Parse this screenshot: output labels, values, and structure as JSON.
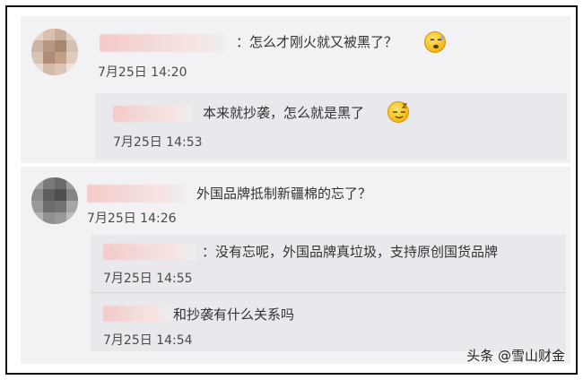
{
  "comments": [
    {
      "text": "：怎么才刚火就又被黑了？",
      "time": "7月25日 14:20",
      "emoji": "sweat-face-emoji",
      "replies": [
        {
          "text": "本来就抄袭，怎么就是黑了",
          "time": "7月25日 14:53",
          "emoji": "sleepy-face-emoji"
        }
      ]
    },
    {
      "text": "外国品牌抵制新疆棉的忘了？",
      "time": "7月25日 14:26",
      "replies": [
        {
          "text": "：没有忘呢，外国品牌真垃圾，支持原创国货品牌",
          "time": "7月25日 14:55"
        },
        {
          "text": "和抄袭有什么关系吗",
          "time": "7月25日 14:54"
        }
      ]
    }
  ],
  "watermark": "头条 @雪山财金"
}
